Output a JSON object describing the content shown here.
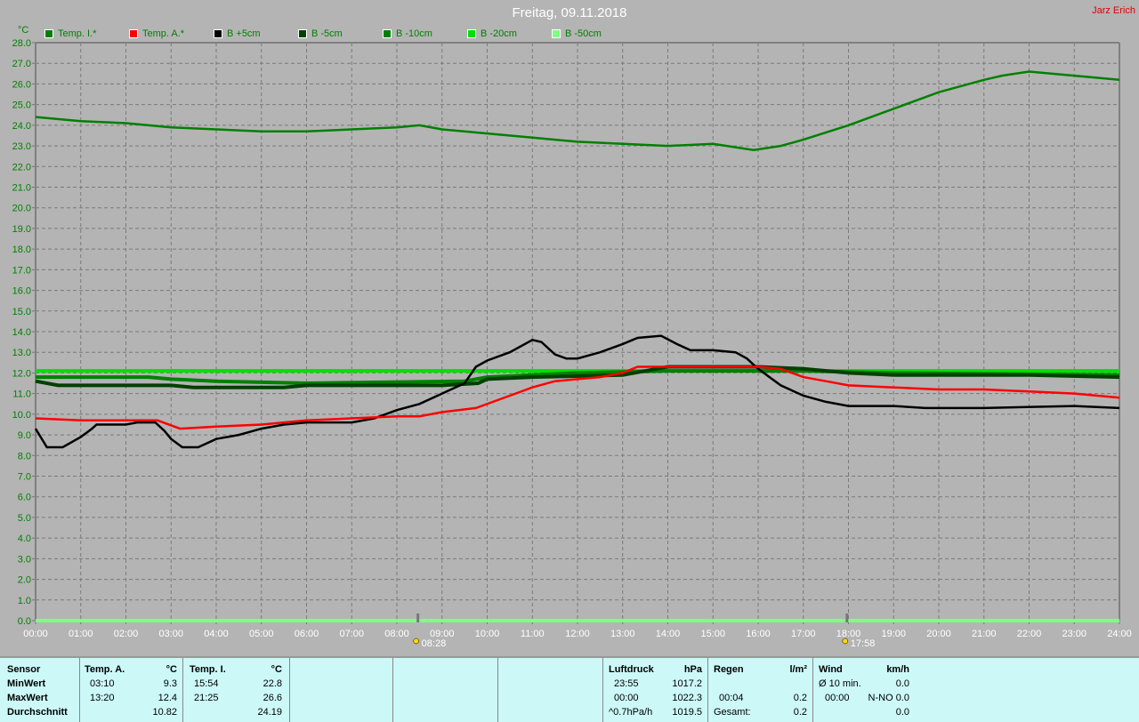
{
  "header": {
    "title": "Freitag, 09.11.2018",
    "author": "Jarz Erich"
  },
  "sun": {
    "sunrise": "08:28",
    "sunset": "17:58"
  },
  "chart_data": {
    "type": "line",
    "title": "Freitag, 09.11.2018",
    "ylabel": "°C",
    "ylim": [
      0,
      28
    ],
    "xlim": [
      0,
      24
    ],
    "grid": true,
    "legend": "top",
    "yticks": [
      "0.0",
      "1.0",
      "2.0",
      "3.0",
      "4.0",
      "5.0",
      "6.0",
      "7.0",
      "8.0",
      "9.0",
      "10.0",
      "11.0",
      "12.0",
      "13.0",
      "14.0",
      "15.0",
      "16.0",
      "17.0",
      "18.0",
      "19.0",
      "20.0",
      "21.0",
      "22.0",
      "23.0",
      "24.0",
      "25.0",
      "26.0",
      "27.0",
      "28.0"
    ],
    "xticks": [
      "00:00",
      "01:00",
      "02:00",
      "03:00",
      "04:00",
      "05:00",
      "06:00",
      "07:00",
      "08:00",
      "09:00",
      "10:00",
      "11:00",
      "12:00",
      "13:00",
      "14:00",
      "15:00",
      "16:00",
      "17:00",
      "18:00",
      "19:00",
      "20:00",
      "21:00",
      "22:00",
      "23:00",
      "24:00"
    ],
    "series": [
      {
        "name": "Temp. I.*",
        "color": "#008000",
        "x": [
          0,
          1,
          2,
          3,
          4,
          5,
          6,
          7,
          8,
          8.5,
          9,
          10,
          11,
          12,
          13,
          14,
          15,
          15.9,
          16.5,
          17,
          18,
          19,
          20,
          21,
          21.4,
          22,
          23,
          24
        ],
        "y": [
          24.4,
          24.2,
          24.1,
          23.9,
          23.8,
          23.7,
          23.7,
          23.8,
          23.9,
          24.0,
          23.8,
          23.6,
          23.4,
          23.2,
          23.1,
          23.0,
          23.1,
          22.8,
          23.0,
          23.3,
          24.0,
          24.8,
          25.6,
          26.2,
          26.4,
          26.6,
          26.4,
          26.2
        ]
      },
      {
        "name": "Temp. A.*",
        "color": "#ff0000",
        "x": [
          0,
          1,
          2,
          2.7,
          3.2,
          4,
          5,
          5.5,
          6,
          7,
          8,
          8.5,
          9,
          9.75,
          10.5,
          11,
          11.5,
          12,
          12.5,
          13,
          13.33,
          14,
          15,
          16,
          16.5,
          17,
          17.5,
          18,
          19,
          20,
          21,
          22,
          23,
          24
        ],
        "y": [
          9.8,
          9.7,
          9.7,
          9.7,
          9.3,
          9.4,
          9.5,
          9.6,
          9.7,
          9.8,
          9.9,
          9.9,
          10.1,
          10.3,
          10.9,
          11.3,
          11.6,
          11.7,
          11.8,
          12.0,
          12.3,
          12.3,
          12.3,
          12.3,
          12.2,
          11.8,
          11.6,
          11.4,
          11.3,
          11.2,
          11.2,
          11.1,
          11.0,
          10.8
        ]
      },
      {
        "name": "B +5cm",
        "color": "#000000",
        "x": [
          0,
          0.25,
          0.6,
          1,
          1.25,
          1.35,
          2,
          2.25,
          2.65,
          2.85,
          3,
          3.25,
          3.6,
          4,
          4.5,
          5,
          5.5,
          6,
          6.5,
          7,
          7.5,
          8,
          8.5,
          9,
          9.5,
          9.75,
          10,
          10.5,
          11,
          11.2,
          11.5,
          11.75,
          12,
          12.5,
          13,
          13.33,
          13.85,
          14.2,
          14.5,
          15,
          15.5,
          15.75,
          16,
          16.5,
          17,
          17.5,
          18,
          19,
          19.7,
          21,
          23,
          24
        ],
        "y": [
          9.3,
          8.4,
          8.4,
          8.9,
          9.3,
          9.5,
          9.5,
          9.6,
          9.6,
          9.2,
          8.8,
          8.4,
          8.4,
          8.8,
          9.0,
          9.3,
          9.5,
          9.6,
          9.6,
          9.6,
          9.8,
          10.2,
          10.5,
          11.0,
          11.5,
          12.3,
          12.6,
          13.0,
          13.6,
          13.5,
          12.9,
          12.7,
          12.7,
          13.0,
          13.4,
          13.7,
          13.8,
          13.4,
          13.1,
          13.1,
          13.0,
          12.7,
          12.2,
          11.4,
          10.9,
          10.6,
          10.4,
          10.4,
          10.3,
          10.3,
          10.4,
          10.3
        ]
      },
      {
        "name": "B -5cm",
        "color": "#004000",
        "x": [
          0,
          0.5,
          1,
          3,
          3.5,
          5.5,
          6,
          8,
          9,
          9.8,
          10,
          11,
          13,
          14,
          16,
          17,
          18,
          19,
          20,
          22,
          24
        ],
        "y": [
          11.6,
          11.4,
          11.4,
          11.4,
          11.3,
          11.3,
          11.4,
          11.4,
          11.4,
          11.5,
          11.7,
          11.8,
          11.9,
          12.3,
          12.3,
          12.2,
          12.0,
          11.9,
          11.9,
          11.9,
          11.8
        ]
      },
      {
        "name": "B -10cm",
        "color": "#008000",
        "x": [
          0,
          2.5,
          3,
          4,
          6,
          9.5,
          10,
          11,
          12,
          14,
          17,
          19,
          24
        ],
        "y": [
          11.8,
          11.8,
          11.7,
          11.6,
          11.5,
          11.6,
          11.8,
          11.9,
          12.0,
          12.1,
          12.1,
          12.0,
          11.9
        ]
      },
      {
        "name": "B -20cm",
        "color": "#00e000",
        "x": [
          0,
          24
        ],
        "y": [
          12.1,
          12.1
        ]
      },
      {
        "name": "B -50cm",
        "color": "#80ff80",
        "x": [
          0,
          24
        ],
        "y": [
          0.0,
          0.0
        ]
      }
    ]
  },
  "stats": {
    "sensor_label": "Sensor",
    "min_label": "MinWert",
    "max_label": "MaxWert",
    "avg_label": "Durchschnitt",
    "temp_a": {
      "name": "Temp. A.",
      "unit": "°C",
      "min_time": "03:10",
      "min": "9.3",
      "max_time": "13:20",
      "max": "12.4",
      "avg": "10.82"
    },
    "temp_i": {
      "name": "Temp. I.",
      "unit": "°C",
      "min_time": "15:54",
      "min": "22.8",
      "max_time": "21:25",
      "max": "26.6",
      "avg": "24.19"
    },
    "pressure": {
      "name": "Luftdruck",
      "unit": "hPa",
      "r1_time": "23:55",
      "r1": "1017.2",
      "r2_time": "00:00",
      "r2": "1022.3",
      "r3_label": "^0.7hPa/h",
      "r3": "1019.5"
    },
    "rain": {
      "name": "Regen",
      "unit": "l/m²",
      "r2_time": "00:04",
      "r2": "0.2",
      "r3_label": "Gesamt:",
      "r3": "0.2"
    },
    "wind": {
      "name": "Wind",
      "unit": "km/h",
      "r1_label": "Ø 10 min.",
      "r1": "0.0",
      "r2_time": "00:00",
      "r2": "N-NO 0.0",
      "r3": "0.0"
    }
  }
}
